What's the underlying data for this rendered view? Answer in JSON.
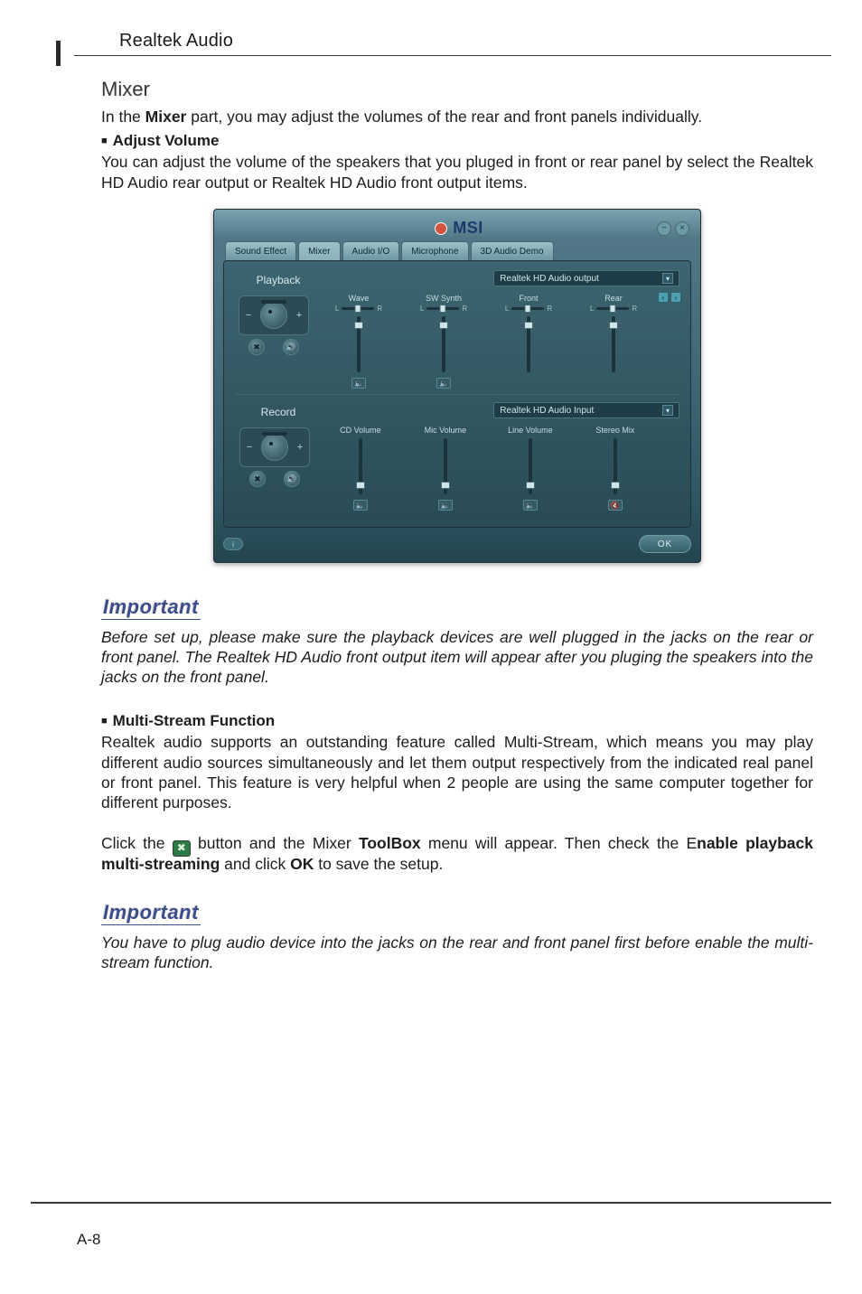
{
  "page": {
    "section_header": "Realtek Audio",
    "page_number": "A-8"
  },
  "mixer": {
    "heading": "Mixer",
    "intro_pre": "In the ",
    "intro_strong": "Mixer",
    "intro_post": " part, you may adjust the volumes of the rear and front panels individually.",
    "adjust_volume_h": "Adjust Volume",
    "adjust_volume_p": "You can adjust the volume of the speakers that you pluged in front or rear panel by select the Realtek HD Audio rear output or Realtek HD Audio front output items."
  },
  "important1": {
    "label": "Important",
    "text": "Before set up, please make sure the playback devices are well plugged in the jacks on the rear or front panel. The Realtek HD Audio front output item will appear after you pluging the speakers into the jacks on the front panel."
  },
  "multi": {
    "heading": "Multi-Stream Function",
    "p": "Realtek audio supports an outstanding feature called Multi-Stream, which means you may play different audio sources simultaneously and let them output respectively from the indicated real panel or front panel. This feature is very helpful when 2 people are using the same computer together for different purposes.",
    "click_pre": "Click the ",
    "click_mid1": " button and the Mixer ",
    "click_bold1": "ToolBox",
    "click_mid2": " menu will appear. Then check the E",
    "click_bold2": "nable playback multi-streaming",
    "click_mid3": " and click ",
    "click_bold3": "OK",
    "click_post": " to save the setup."
  },
  "important2": {
    "label": "Important",
    "text": "You have to plug audio device into the jacks on the rear and front panel first before enable the multi-stream function."
  },
  "app": {
    "brand": "MSI",
    "tabs": [
      "Sound Effect",
      "Mixer",
      "Audio I/O",
      "Microphone",
      "3D Audio Demo"
    ],
    "playback": {
      "label": "Playback",
      "device": "Realtek HD Audio output",
      "channels": [
        {
          "name": "Wave",
          "balance_l": "L",
          "balance_r": "R",
          "knob_top_pct": 10
        },
        {
          "name": "SW Synth",
          "balance_l": "L",
          "balance_r": "R",
          "knob_top_pct": 10
        },
        {
          "name": "Front",
          "balance_l": "L",
          "balance_r": "R",
          "knob_top_pct": 10
        },
        {
          "name": "Rear",
          "balance_l": "L",
          "balance_r": "R",
          "knob_top_pct": 10
        }
      ]
    },
    "record": {
      "label": "Record",
      "device": "Realtek HD Audio Input",
      "channels": [
        {
          "name": "CD Volume",
          "knob_top_pct": 80
        },
        {
          "name": "Mic Volume",
          "knob_top_pct": 80
        },
        {
          "name": "Line Volume",
          "knob_top_pct": 80
        },
        {
          "name": "Stereo Mix",
          "knob_top_pct": 80
        }
      ]
    },
    "ok": "OK"
  }
}
